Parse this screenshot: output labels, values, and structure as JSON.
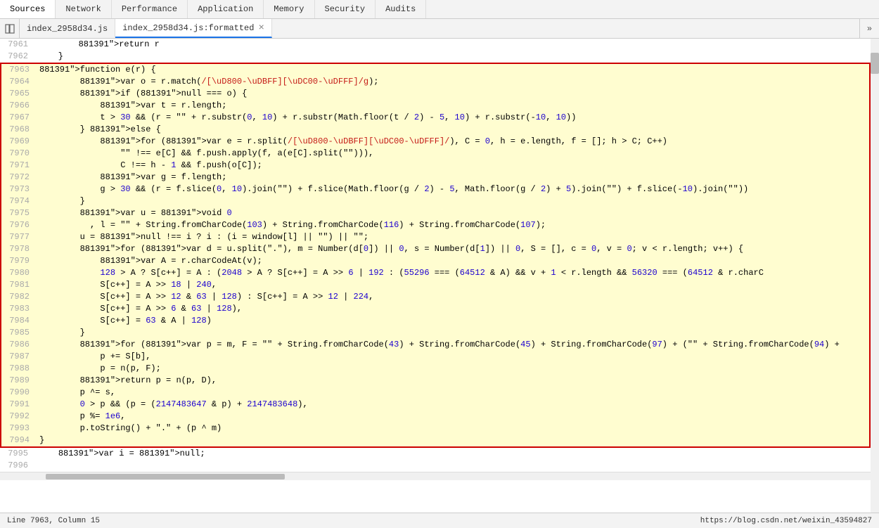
{
  "nav": {
    "tabs": [
      {
        "label": "Sources",
        "active": true
      },
      {
        "label": "Network",
        "active": false
      },
      {
        "label": "Performance",
        "active": false
      },
      {
        "label": "Application",
        "active": false
      },
      {
        "label": "Memory",
        "active": false
      },
      {
        "label": "Security",
        "active": false
      },
      {
        "label": "Audits",
        "active": false
      }
    ]
  },
  "fileTabs": {
    "tabs": [
      {
        "label": "index_2958d34.js",
        "active": false,
        "closeable": false
      },
      {
        "label": "index_2958d34.js:formatted",
        "active": true,
        "closeable": true
      }
    ]
  },
  "statusBar": {
    "position": "Line 7963, Column 15",
    "url": "https://blog.csdn.net/weixin_43594827"
  },
  "codeLines": [
    {
      "num": 7961,
      "content": "        return r",
      "highlight": false
    },
    {
      "num": 7962,
      "content": "    }",
      "highlight": false
    },
    {
      "num": 7963,
      "content": "function e(r) {",
      "highlight": true,
      "borderTop": true
    },
    {
      "num": 7964,
      "content": "        var o = r.match(/[\\uD800-\\uDBFF][\\uDC00-\\uDFFF]/g);",
      "highlight": true
    },
    {
      "num": 7965,
      "content": "        if (null === o) {",
      "highlight": true
    },
    {
      "num": 7966,
      "content": "            var t = r.length;",
      "highlight": true
    },
    {
      "num": 7967,
      "content": "            t > 30 && (r = \"\" + r.substr(0, 10) + r.substr(Math.floor(t / 2) - 5, 10) + r.substr(-10, 10))",
      "highlight": true
    },
    {
      "num": 7968,
      "content": "        } else {",
      "highlight": true
    },
    {
      "num": 7969,
      "content": "            for (var e = r.split(/[\\uD800-\\uDBFF][\\uDC00-\\uDFFF]/), C = 0, h = e.length, f = []; h > C; C++)",
      "highlight": true
    },
    {
      "num": 7970,
      "content": "                \"\" !== e[C] && f.push.apply(f, a(e[C].split(\"\"))),",
      "highlight": true
    },
    {
      "num": 7971,
      "content": "                C !== h - 1 && f.push(o[C]);",
      "highlight": true
    },
    {
      "num": 7972,
      "content": "            var g = f.length;",
      "highlight": true
    },
    {
      "num": 7973,
      "content": "            g > 30 && (r = f.slice(0, 10).join(\"\") + f.slice(Math.floor(g / 2) - 5, Math.floor(g / 2) + 5).join(\"\") + f.slice(-10).join(\"\"))",
      "highlight": true
    },
    {
      "num": 7974,
      "content": "        }",
      "highlight": true
    },
    {
      "num": 7975,
      "content": "        var u = void 0",
      "highlight": true
    },
    {
      "num": 7976,
      "content": "          , l = \"\" + String.fromCharCode(103) + String.fromCharCode(116) + String.fromCharCode(107);",
      "highlight": true
    },
    {
      "num": 7977,
      "content": "        u = null !== i ? i : (i = window[l] || \"\") || \"\";",
      "highlight": true
    },
    {
      "num": 7978,
      "content": "        for (var d = u.split(\".\"), m = Number(d[0]) || 0, s = Number(d[1]) || 0, S = [], c = 0, v = 0; v < r.length; v++) {",
      "highlight": true
    },
    {
      "num": 7979,
      "content": "            var A = r.charCodeAt(v);",
      "highlight": true
    },
    {
      "num": 7980,
      "content": "            128 > A ? S[c++] = A : (2048 > A ? S[c++] = A >> 6 | 192 : (55296 === (64512 & A) && v + 1 < r.length && 56320 === (64512 & r.charC",
      "highlight": true
    },
    {
      "num": 7981,
      "content": "            S[c++] = A >> 18 | 240,",
      "highlight": true
    },
    {
      "num": 7982,
      "content": "            S[c++] = A >> 12 & 63 | 128) : S[c++] = A >> 12 | 224,",
      "highlight": true
    },
    {
      "num": 7983,
      "content": "            S[c++] = A >> 6 & 63 | 128),",
      "highlight": true
    },
    {
      "num": 7984,
      "content": "            S[c++] = 63 & A | 128)",
      "highlight": true
    },
    {
      "num": 7985,
      "content": "        }",
      "highlight": true
    },
    {
      "num": 7986,
      "content": "        for (var p = m, F = \"\" + String.fromCharCode(43) + String.fromCharCode(45) + String.fromCharCode(97) + (\"\" + String.fromCharCode(94) +",
      "highlight": true
    },
    {
      "num": 7987,
      "content": "            p += S[b],",
      "highlight": true
    },
    {
      "num": 7988,
      "content": "            p = n(p, F);",
      "highlight": true
    },
    {
      "num": 7989,
      "content": "        return p = n(p, D),",
      "highlight": true
    },
    {
      "num": 7990,
      "content": "        p ^= s,",
      "highlight": true
    },
    {
      "num": 7991,
      "content": "        0 > p && (p = (2147483647 & p) + 2147483648),",
      "highlight": true
    },
    {
      "num": 7992,
      "content": "        p %= 1e6,",
      "highlight": true
    },
    {
      "num": 7993,
      "content": "        p.toString() + \".\" + (p ^ m)",
      "highlight": true
    },
    {
      "num": 7994,
      "content": "}",
      "highlight": true,
      "borderBottom": true
    },
    {
      "num": 7995,
      "content": "    var i = null;",
      "highlight": false
    },
    {
      "num": 7996,
      "content": "",
      "highlight": false
    }
  ]
}
